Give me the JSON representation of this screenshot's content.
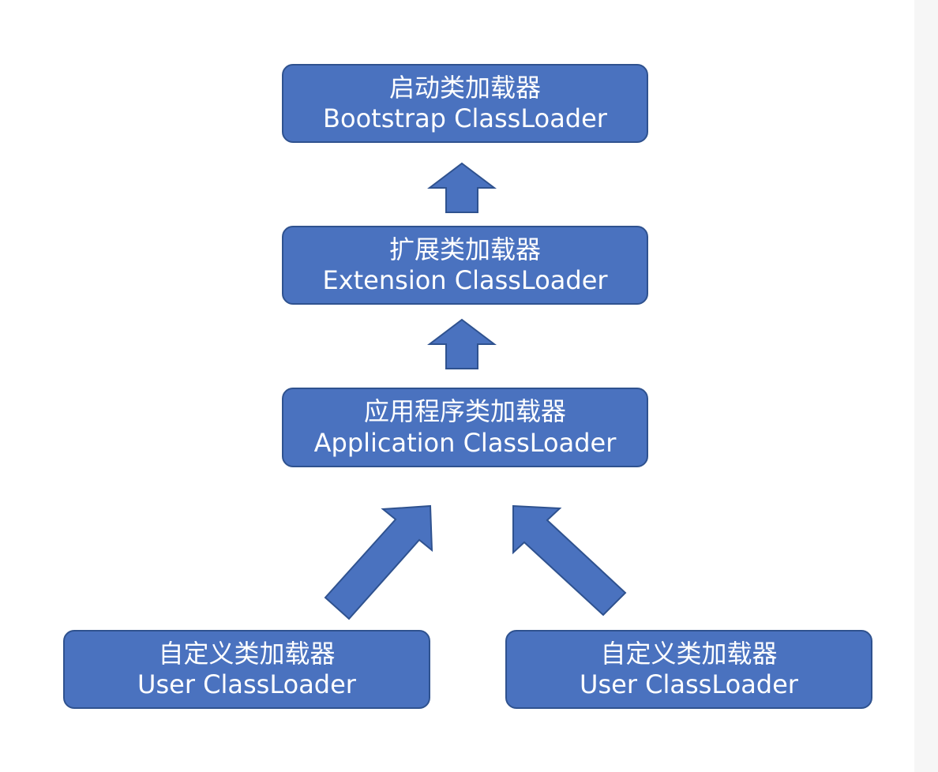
{
  "diagram": {
    "nodes": {
      "bootstrap": {
        "zh": "启动类加载器",
        "en": "Bootstrap ClassLoader"
      },
      "extension": {
        "zh": "扩展类加载器",
        "en": "Extension ClassLoader"
      },
      "application": {
        "zh": "应用程序类加载器",
        "en": "Application ClassLoader"
      },
      "user_left": {
        "zh": "自定义类加载器",
        "en": "User ClassLoader"
      },
      "user_right": {
        "zh": "自定义类加载器",
        "en": "User ClassLoader"
      }
    },
    "edges": [
      {
        "from": "extension",
        "to": "bootstrap"
      },
      {
        "from": "application",
        "to": "extension"
      },
      {
        "from": "user_left",
        "to": "application"
      },
      {
        "from": "user_right",
        "to": "application"
      }
    ],
    "colors": {
      "node_fill": "#4a72bf",
      "node_border": "#2f528f",
      "text": "#ffffff",
      "background": "#ffffff"
    }
  }
}
